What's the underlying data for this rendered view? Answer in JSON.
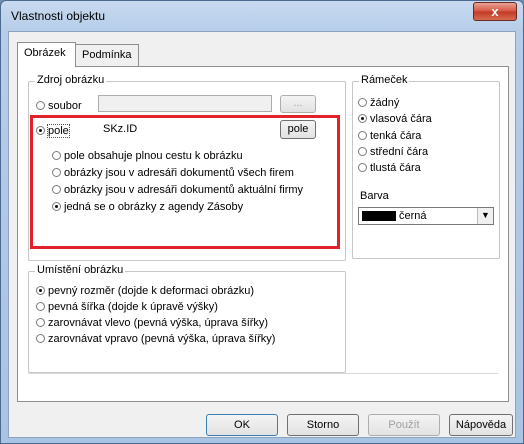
{
  "window": {
    "title": "Vlastnosti objektu",
    "close_glyph": "x"
  },
  "tabs": [
    {
      "label": "Obrázek",
      "active": true
    },
    {
      "label": "Podmínka",
      "active": false
    }
  ],
  "source_group": {
    "legend": "Zdroj obrázku",
    "soubor": {
      "label": "soubor",
      "value": "",
      "button": "...",
      "checked": false
    },
    "pole": {
      "label": "pole",
      "value": "SKz.ID",
      "button": "pole",
      "checked": true
    },
    "options": [
      {
        "label": "pole obsahuje plnou cestu k obrázku",
        "checked": false
      },
      {
        "label": "obrázky jsou v adresáři dokumentů všech firem",
        "checked": false
      },
      {
        "label": "obrázky jsou v adresáři dokumentů aktuální firmy",
        "checked": false
      },
      {
        "label": "jedná se o obrázky z agendy Zásoby",
        "checked": true
      }
    ]
  },
  "placement_group": {
    "legend": "Umístění obrázku",
    "options": [
      {
        "label": "pevný rozměr (dojde k deformaci obrázku)",
        "checked": true
      },
      {
        "label": "pevná šířka (dojde k úpravě výšky)",
        "checked": false
      },
      {
        "label": "zarovnávat vlevo (pevná výška, úprava šířky)",
        "checked": false
      },
      {
        "label": "zarovnávat vpravo (pevná výška, úprava šířky)",
        "checked": false
      }
    ]
  },
  "frame_group": {
    "legend": "Rámeček",
    "options": [
      {
        "label": "žádný",
        "checked": false
      },
      {
        "label": "vlasová čára",
        "checked": true
      },
      {
        "label": "tenká čára",
        "checked": false
      },
      {
        "label": "střední čára",
        "checked": false
      },
      {
        "label": "tlustá čára",
        "checked": false
      }
    ]
  },
  "color": {
    "label": "Barva",
    "value": "černá",
    "swatch_color": "#000000"
  },
  "buttons": {
    "ok": "OK",
    "cancel": "Storno",
    "apply": "Použít",
    "help": "Nápověda"
  },
  "colors": {
    "highlight_border": "#e2212a",
    "close_button": "#c23a24"
  }
}
